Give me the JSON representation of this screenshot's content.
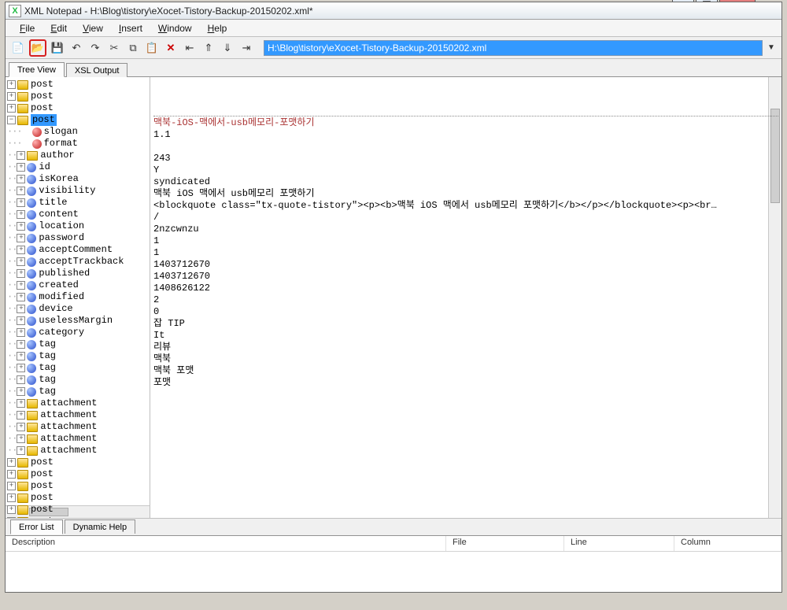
{
  "window": {
    "app_icon_letter": "X",
    "title": "XML Notepad - H:\\Blog\\tistory\\eXocet-Tistory-Backup-20150202.xml*"
  },
  "menu": {
    "file": "File",
    "edit": "Edit",
    "view": "View",
    "insert": "Insert",
    "window": "Window",
    "help": "Help"
  },
  "toolbar": {
    "address": "H:\\Blog\\tistory\\eXocet-Tistory-Backup-20150202.xml"
  },
  "tabs": {
    "tree_view": "Tree View",
    "xsl_output": "XSL Output",
    "error_list": "Error List",
    "dynamic_help": "Dynamic Help"
  },
  "tree": {
    "posts_before": [
      "post",
      "post",
      "post"
    ],
    "selected_post": "post",
    "slogan": "slogan",
    "format": "format",
    "author": "author",
    "fields": [
      "id",
      "isKorea",
      "visibility",
      "title",
      "content",
      "location",
      "password",
      "acceptComment",
      "acceptTrackback",
      "published",
      "created",
      "modified",
      "device",
      "uselessMargin",
      "category",
      "tag",
      "tag",
      "tag",
      "tag",
      "tag"
    ],
    "attachments": [
      "attachment",
      "attachment",
      "attachment",
      "attachment",
      "attachment"
    ],
    "posts_after": [
      "post",
      "post",
      "post",
      "post",
      "post",
      "post"
    ]
  },
  "values": {
    "slogan": "맥북-iOS-맥에서-usb메모리-포맷하기",
    "format": "1.1",
    "author": "",
    "id": "243",
    "isKorea": "Y",
    "visibility": "syndicated",
    "title": "맥북 iOS 맥에서 usb메모리 포맷하기",
    "content": "<blockquote class=\"tx-quote-tistory\"><p><b>맥북 iOS 맥에서 usb메모리 포맷하기</b></p></blockquote><p><br…",
    "location": "/",
    "password": "2nzcwnzu",
    "acceptComment": "1",
    "acceptTrackback": "1",
    "published": "1403712670",
    "created": "1403712670",
    "modified": "1408626122",
    "device": "2",
    "uselessMargin": "0",
    "category": "잡 TIP",
    "tag1": "It",
    "tag2": "리뷰",
    "tag3": "맥북",
    "tag4": "맥북 포맷",
    "tag5": "포맷"
  },
  "error_columns": {
    "description": "Description",
    "file": "File",
    "line": "Line",
    "column": "Column"
  }
}
